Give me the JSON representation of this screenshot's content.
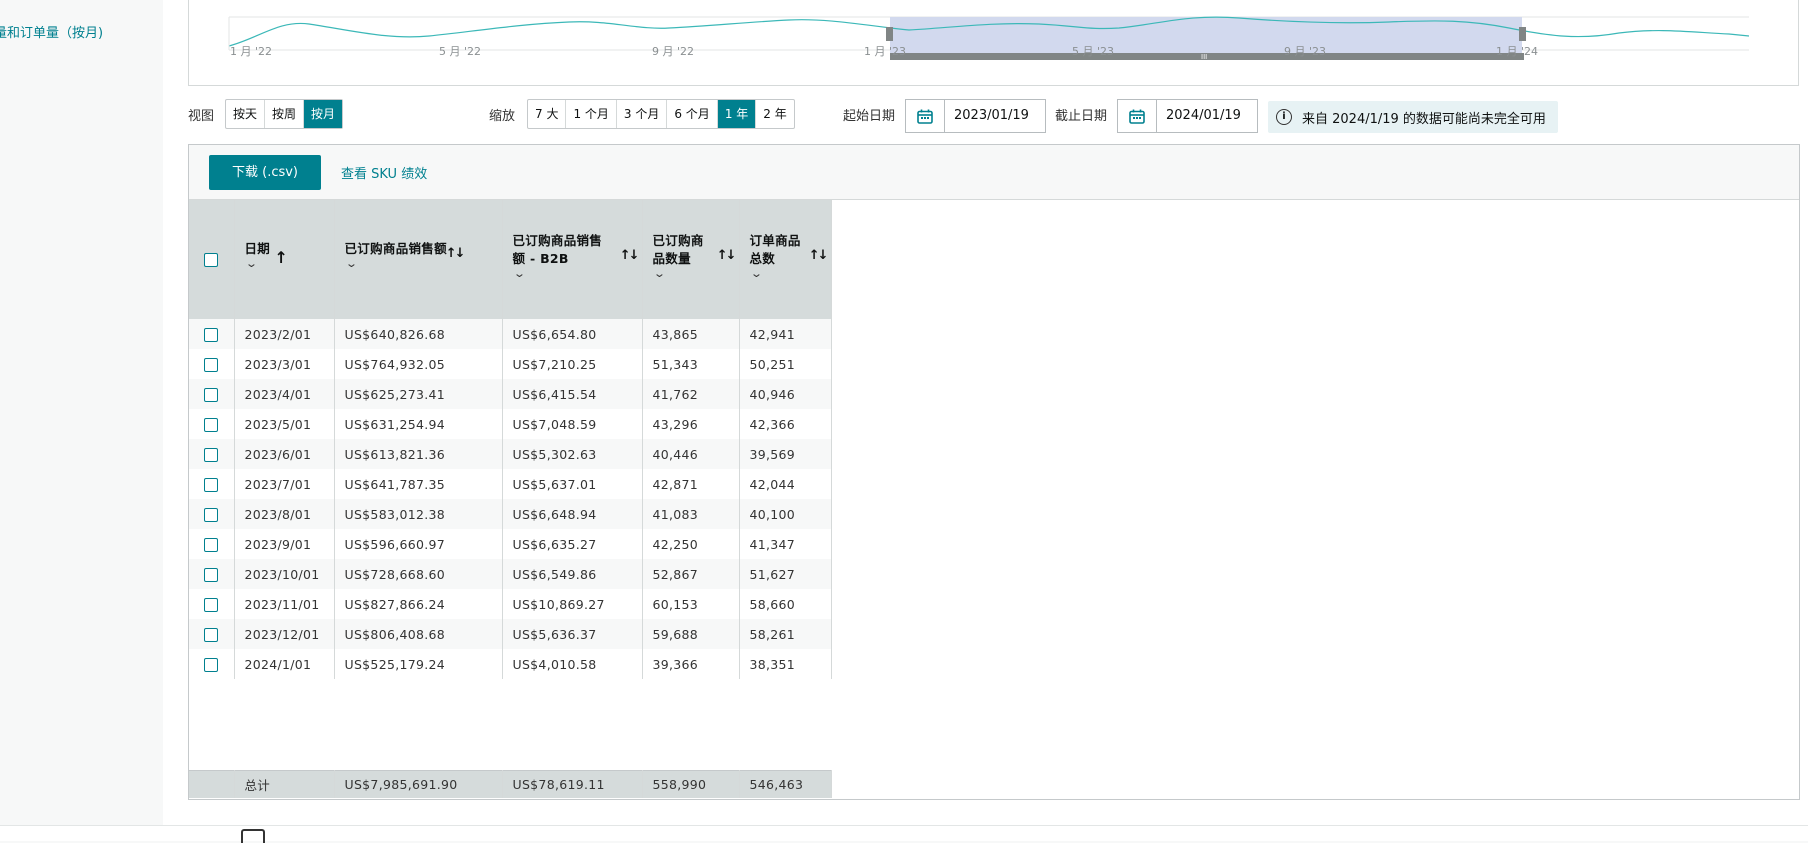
{
  "left_panel": {
    "link_label": "量和订单量（按月)"
  },
  "overview": {
    "ticks": [
      "1 月 '22",
      "5 月 '22",
      "9 月 '22",
      "1 月 '23",
      "5 月 '23",
      "9 月 '23",
      "1 月 '24"
    ],
    "selection": {
      "start": "1 月 '23",
      "end": "1 月 '24"
    },
    "colors": {
      "line": "#3cb8b8",
      "selection": "#d2d9ee",
      "handle": "#808585"
    }
  },
  "controls": {
    "view_label": "视图",
    "view_options": [
      "按天",
      "按周",
      "按月"
    ],
    "view_selected": "按月",
    "zoom_label": "缩放",
    "zoom_options": [
      "7 大",
      "1 个月",
      "3 个月",
      "6 个月",
      "1 年",
      "2 年"
    ],
    "zoom_selected": "1 年",
    "start_label": "起始日期",
    "start_value": "2023/01/19",
    "end_label": "截止日期",
    "end_value": "2024/01/19",
    "info_text": "来自 2024/1/19 的数据可能尚未完全可用"
  },
  "toolbar": {
    "download_label": "下载 (.csv)",
    "sku_link": "查看 SKU 绩效"
  },
  "table": {
    "headers": [
      "日期",
      "已订购商品销售额",
      "已订购商品销售额 - B2B",
      "已订购商品数量",
      "订单商品总数"
    ],
    "rows": [
      [
        "2023/2/01",
        "US$640,826.68",
        "US$6,654.80",
        "43,865",
        "42,941"
      ],
      [
        "2023/3/01",
        "US$764,932.05",
        "US$7,210.25",
        "51,343",
        "50,251"
      ],
      [
        "2023/4/01",
        "US$625,273.41",
        "US$6,415.54",
        "41,762",
        "40,946"
      ],
      [
        "2023/5/01",
        "US$631,254.94",
        "US$7,048.59",
        "43,296",
        "42,366"
      ],
      [
        "2023/6/01",
        "US$613,821.36",
        "US$5,302.63",
        "40,446",
        "39,569"
      ],
      [
        "2023/7/01",
        "US$641,787.35",
        "US$5,637.01",
        "42,871",
        "42,044"
      ],
      [
        "2023/8/01",
        "US$583,012.38",
        "US$6,648.94",
        "41,083",
        "40,100"
      ],
      [
        "2023/9/01",
        "US$596,660.97",
        "US$6,635.27",
        "42,250",
        "41,347"
      ],
      [
        "2023/10/01",
        "US$728,668.60",
        "US$6,549.86",
        "52,867",
        "51,627"
      ],
      [
        "2023/11/01",
        "US$827,866.24",
        "US$10,869.27",
        "60,153",
        "58,660"
      ],
      [
        "2023/12/01",
        "US$806,408.68",
        "US$5,636.37",
        "59,688",
        "58,261"
      ],
      [
        "2024/1/01",
        "US$525,179.24",
        "US$4,010.58",
        "39,366",
        "38,351"
      ]
    ],
    "totals": [
      "总计",
      "US$7,985,691.90",
      "US$78,619.11",
      "558,990",
      "546,463"
    ]
  },
  "colors": {
    "accent": "#00808f",
    "header_bg": "#d5dbdb",
    "info_bg": "#e7f2f4"
  }
}
